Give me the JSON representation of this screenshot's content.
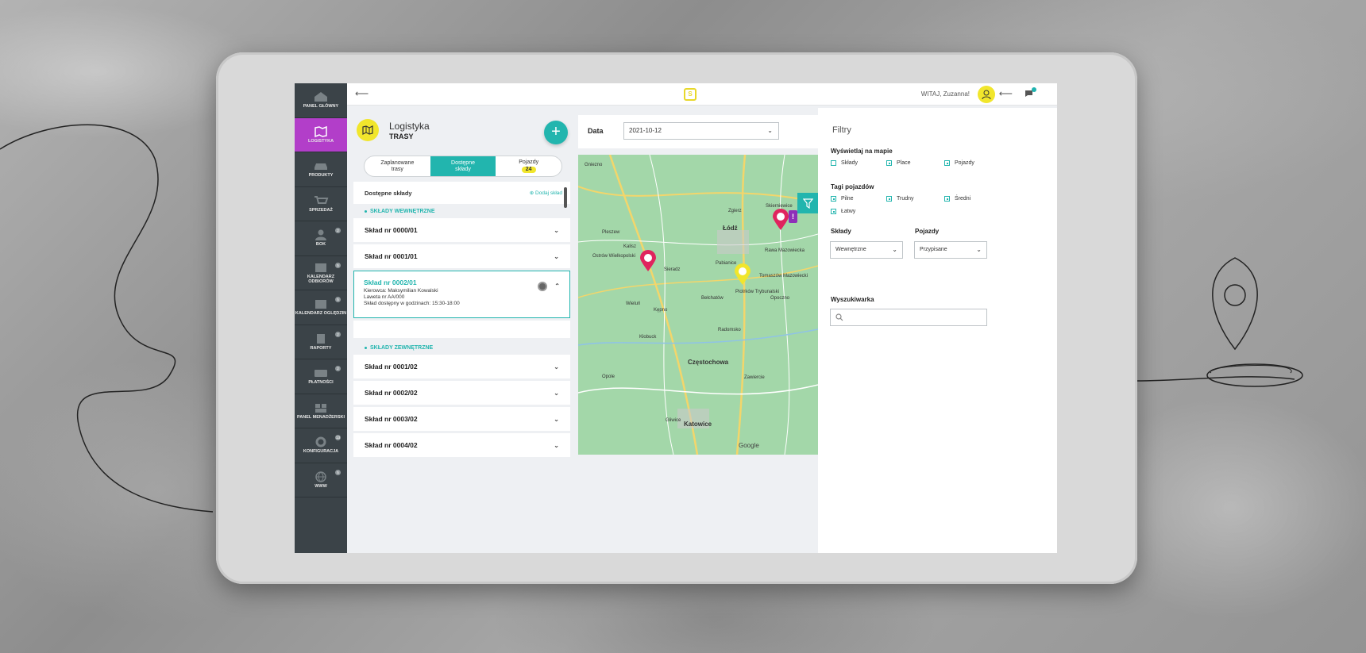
{
  "sidebar": {
    "items": [
      {
        "label": "Panel główny",
        "badge": ""
      },
      {
        "label": "Logistyka",
        "badge": "",
        "active": true
      },
      {
        "label": "Produkty",
        "badge": ""
      },
      {
        "label": "Sprzedaż",
        "badge": ""
      },
      {
        "label": "BOK",
        "badge": "2"
      },
      {
        "label": "Kalendarz odbiorów",
        "badge": "5"
      },
      {
        "label": "Kalendarz oględzin",
        "badge": "5"
      },
      {
        "label": "Raporty",
        "badge": "2"
      },
      {
        "label": "Płatności",
        "badge": "2"
      },
      {
        "label": "Panel menadżerski",
        "badge": ""
      },
      {
        "label": "Konfiguracja",
        "badge": "13"
      },
      {
        "label": "WWW",
        "badge": "5"
      }
    ]
  },
  "topbar": {
    "back": "⟵",
    "logo_glyph": "S",
    "greeting": "WITAJ, Zuzanna!",
    "logout": "⟵",
    "messages_icon": "chat-icon"
  },
  "panel": {
    "title": "Logistyka",
    "subtitle": "TRASY",
    "add_label": "+"
  },
  "tabs": [
    {
      "label": "Zaplanowane trasy",
      "count": ""
    },
    {
      "label": "Dostępne składy",
      "count": "",
      "active": true
    },
    {
      "label": "Pojazdy",
      "count": "24"
    }
  ],
  "list": {
    "header": "Dostępne składy",
    "add_link": "Dodaj skład",
    "internal_section": "Składy wewnętrzne",
    "internal": [
      {
        "title": "Skład nr 0000/01"
      },
      {
        "title": "Skład nr 0001/01"
      }
    ],
    "expanded": {
      "title": "Skład nr 0002/01",
      "driver": "Kierowca: Maksymilian Kowalski",
      "vehicle": "Laweta nr AA/000",
      "hours": "Skład dostępny w godzinach: 15:30-18:00"
    },
    "external_section": "Składy zewnętrzne",
    "external": [
      {
        "title": "Skład nr 0001/02"
      },
      {
        "title": "Skład nr 0002/02"
      },
      {
        "title": "Skład nr 0003/02"
      },
      {
        "title": "Skład nr 0004/02"
      }
    ]
  },
  "date": {
    "label": "Data",
    "value": "2021-10-12"
  },
  "map": {
    "cities": [
      {
        "name": "Łódź"
      },
      {
        "name": "Częstochowa"
      },
      {
        "name": "Katowice"
      },
      {
        "name": "Kalisz"
      },
      {
        "name": "Sieradz"
      },
      {
        "name": "Piotrków Trybunalski"
      },
      {
        "name": "Pabianice"
      },
      {
        "name": "Opole"
      },
      {
        "name": "Radomsko"
      },
      {
        "name": "Bełchatów"
      },
      {
        "name": "Kłobuck"
      },
      {
        "name": "Kępno"
      },
      {
        "name": "Wieluń"
      },
      {
        "name": "Zgierz"
      },
      {
        "name": "Tomaszów Mazowiecki"
      },
      {
        "name": "Opoczno"
      },
      {
        "name": "Skierniewice"
      },
      {
        "name": "Gniezno"
      },
      {
        "name": "Pleszew"
      },
      {
        "name": "Gliwice"
      },
      {
        "name": "Zawiercie"
      },
      {
        "name": "Rawa Mazowiecka"
      },
      {
        "name": "Ostrów Wielkopolski"
      }
    ],
    "attribution": "Google",
    "colors": {
      "pin_red": "#e0245e",
      "pin_yellow": "#f1e62c",
      "alert": "#8e2fb8"
    }
  },
  "filters": {
    "title": "Filtry",
    "show_on_map": {
      "label": "Wyświetlaj na mapie",
      "options": [
        {
          "label": "Składy",
          "checked": false
        },
        {
          "label": "Place",
          "checked": true
        },
        {
          "label": "Pojazdy",
          "checked": true
        }
      ]
    },
    "vehicle_tags": {
      "label": "Tagi pojazdów",
      "options": [
        {
          "label": "Pilne",
          "checked": true
        },
        {
          "label": "Trudny",
          "checked": true
        },
        {
          "label": "Średni",
          "checked": true
        },
        {
          "label": "Łatwy",
          "checked": true
        }
      ]
    },
    "depots": {
      "label": "Składy",
      "value": "Wewnętrzne"
    },
    "vehicles": {
      "label": "Pojazdy",
      "value": "Przypisane"
    },
    "search": {
      "label": "Wyszukiwarka",
      "placeholder": ""
    }
  },
  "colors": {
    "accent": "#22b5ae",
    "active_nav": "#b23ec9",
    "yellow": "#f1e62c",
    "sidebar": "#3b4348"
  }
}
